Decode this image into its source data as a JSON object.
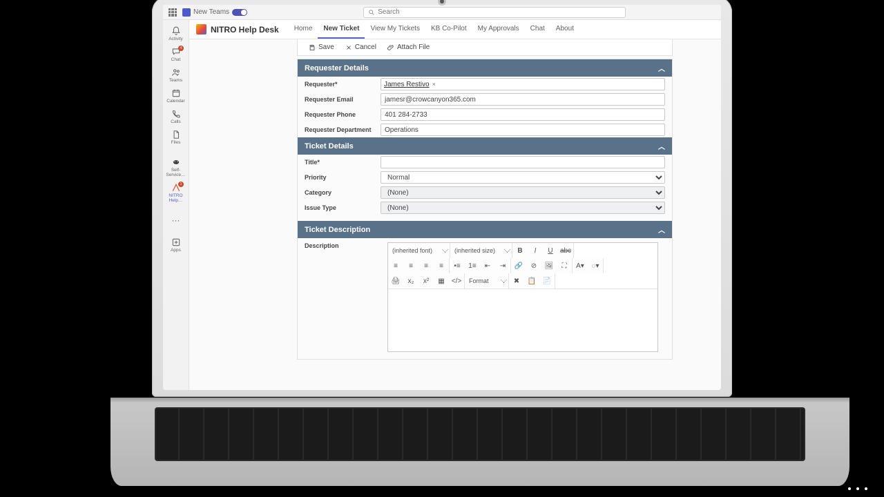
{
  "chrome": {
    "teams_label": "New Teams",
    "search_placeholder": "Search"
  },
  "rail": {
    "items": [
      {
        "label": "Activity",
        "badge": ""
      },
      {
        "label": "Chat",
        "badge": "4"
      },
      {
        "label": "Teams",
        "badge": ""
      },
      {
        "label": "Calendar",
        "badge": ""
      },
      {
        "label": "Calls",
        "badge": ""
      },
      {
        "label": "Files",
        "badge": ""
      },
      {
        "label": "Self-Service…",
        "badge": ""
      },
      {
        "label": "NITRO Help…",
        "badge": "1"
      }
    ],
    "more": "···",
    "apps": "Apps"
  },
  "app": {
    "title": "NITRO Help Desk",
    "tabs": [
      "Home",
      "New Ticket",
      "View My Tickets",
      "KB Co-Pilot",
      "My Approvals",
      "Chat",
      "About"
    ],
    "active_tab": 1
  },
  "actions": {
    "save": "Save",
    "cancel": "Cancel",
    "attach": "Attach File"
  },
  "sections": {
    "requester": {
      "title": "Requester Details",
      "fields": {
        "requester_label": "Requester*",
        "requester_value": "James Restivo",
        "email_label": "Requester Email",
        "email_value": "jamesr@crowcanyon365.com",
        "phone_label": "Requester Phone",
        "phone_value": "401 284-2733",
        "dept_label": "Requester Department",
        "dept_value": "Operations"
      }
    },
    "ticket": {
      "title": "Ticket Details",
      "fields": {
        "title_label": "Title*",
        "title_value": "",
        "priority_label": "Priority",
        "priority_value": "Normal",
        "category_label": "Category",
        "category_value": "(None)",
        "issuetype_label": "Issue Type",
        "issuetype_value": "(None)"
      }
    },
    "description": {
      "title": "Ticket Description",
      "field_label": "Description",
      "font_select": "(inherited font)",
      "size_select": "(inherited size)",
      "format_select": "Format"
    }
  }
}
